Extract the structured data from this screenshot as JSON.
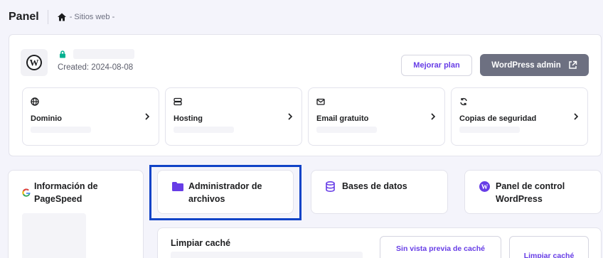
{
  "header": {
    "title": "Panel",
    "breadcrumb": "- Sitios web -"
  },
  "site": {
    "created": "Created: 2024-08-08",
    "upgrade_label": "Mejorar plan",
    "wpadmin_label": "WordPress admin"
  },
  "tiles": [
    {
      "label": "Dominio",
      "icon": "globe-icon"
    },
    {
      "label": "Hosting",
      "icon": "server-icon"
    },
    {
      "label": "Email gratuito",
      "icon": "mail-icon"
    },
    {
      "label": "Copias de seguridad",
      "icon": "backup-icon"
    }
  ],
  "cards": {
    "pagespeed": "Información de PageSpeed",
    "filemanager": "Administrador de archivos",
    "databases": "Bases de datos",
    "wppanel": "Panel de control WordPress"
  },
  "cache": {
    "title": "Limpiar caché",
    "no_preview_label": "Sin vista previa de caché",
    "clear_label": "Limpiar caché"
  },
  "colors": {
    "accent": "#673de6",
    "highlight": "#1043c7",
    "lock": "#00b090",
    "wpadmin_bg": "#6d7081"
  }
}
